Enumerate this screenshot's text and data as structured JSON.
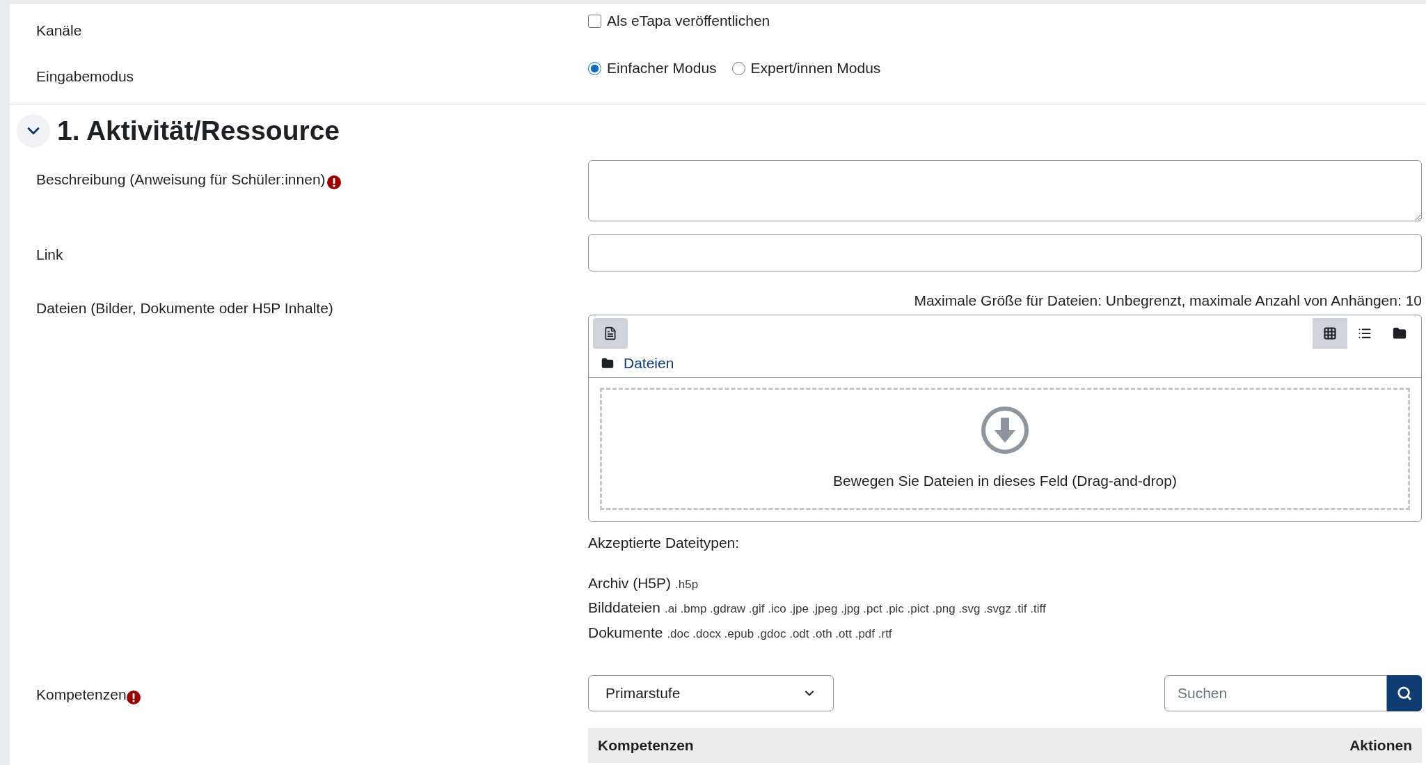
{
  "channels": {
    "label": "Kanäle",
    "checkbox": {
      "label": "Als eTapa veröffentlichen",
      "checked": false
    }
  },
  "input_mode": {
    "label": "Eingabemodus",
    "options": [
      {
        "label": "Einfacher Modus",
        "selected": true
      },
      {
        "label": "Expert/innen Modus",
        "selected": false
      }
    ]
  },
  "section": {
    "title": "1. Aktivität/Ressource",
    "expanded": true
  },
  "description": {
    "label": "Beschreibung (Anweisung für Schüler:innen)",
    "required": true
  },
  "link": {
    "label": "Link"
  },
  "files": {
    "label": "Dateien (Bilder, Dokumente oder H5P Inhalte)",
    "limits": "Maximale Größe für Dateien: Unbegrenzt, maximale Anzahl von Anhängen: 10",
    "path": "Dateien",
    "dropzone_text": "Bewegen Sie Dateien in dieses Feld (Drag-and-drop)",
    "view_buttons": [
      {
        "kind": "grid",
        "selected": true
      },
      {
        "kind": "list",
        "selected": false
      },
      {
        "kind": "folder",
        "selected": false
      }
    ],
    "accepted_title": "Akzeptierte Dateitypen:",
    "accepted_types": [
      {
        "name": "Archiv (H5P)",
        "extensions": ".h5p"
      },
      {
        "name": "Bilddateien",
        "extensions": ".ai .bmp .gdraw .gif .ico .jpe .jpeg .jpg .pct .pic .pict .png .svg .svgz .tif .tiff"
      },
      {
        "name": "Dokumente",
        "extensions": ".doc .docx .epub .gdoc .odt .oth .ott .pdf .rtf"
      }
    ]
  },
  "competences": {
    "label": "Kompetenzen",
    "required": true,
    "select_value": "Primarstufe",
    "search_placeholder": "Suchen",
    "table_columns": [
      "Kompetenzen",
      "Aktionen"
    ]
  }
}
